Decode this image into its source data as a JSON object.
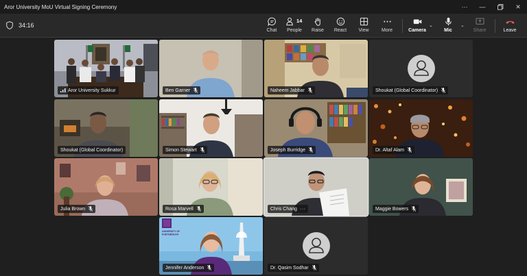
{
  "window": {
    "title": "Aror University MoU Virtual Signing Ceremony",
    "controls": [
      "more-options",
      "minimize",
      "maximize",
      "close"
    ]
  },
  "toolbar": {
    "timer": "34:16",
    "people_count": "14",
    "buttons": {
      "chat": "Chat",
      "people": "People",
      "raise": "Raise",
      "react": "React",
      "view": "View",
      "more": "More",
      "camera": "Camera",
      "mic": "Mic",
      "share": "Share",
      "leave": "Leave"
    },
    "leave_color": "#e0595b"
  },
  "participants": [
    {
      "name": "Aror University Sukkur",
      "video": true,
      "muted": false,
      "signal": true
    },
    {
      "name": "Ben Garner",
      "video": true,
      "muted": true
    },
    {
      "name": "Naheem Jabbar",
      "video": true,
      "muted": true
    },
    {
      "name": "Shoukat (Global Coordinator)",
      "video": false,
      "muted": true
    },
    {
      "name": "Shoukat (Global Coordinator)",
      "video": true,
      "muted": false
    },
    {
      "name": "Simon Stewart",
      "video": true,
      "muted": true
    },
    {
      "name": "Joseph Burridge",
      "video": true,
      "muted": true
    },
    {
      "name": "Dr. Altaf Alam",
      "video": true,
      "muted": true
    },
    {
      "name": "Julia Brown",
      "video": true,
      "muted": true
    },
    {
      "name": "Rosa Marvell",
      "video": true,
      "muted": true
    },
    {
      "name": "Chris Chang",
      "video": true,
      "muted": false,
      "speaking": true,
      "more": "···"
    },
    {
      "name": "Maggie Bowers",
      "video": true,
      "muted": true
    },
    {
      "name": "Jennifer Anderson",
      "video": true,
      "muted": true,
      "logo_text": "UNIVERSITY OF PORTSMOUTH"
    },
    {
      "name": "Dr. Qasim Sodhar",
      "video": false,
      "muted": true
    }
  ]
}
